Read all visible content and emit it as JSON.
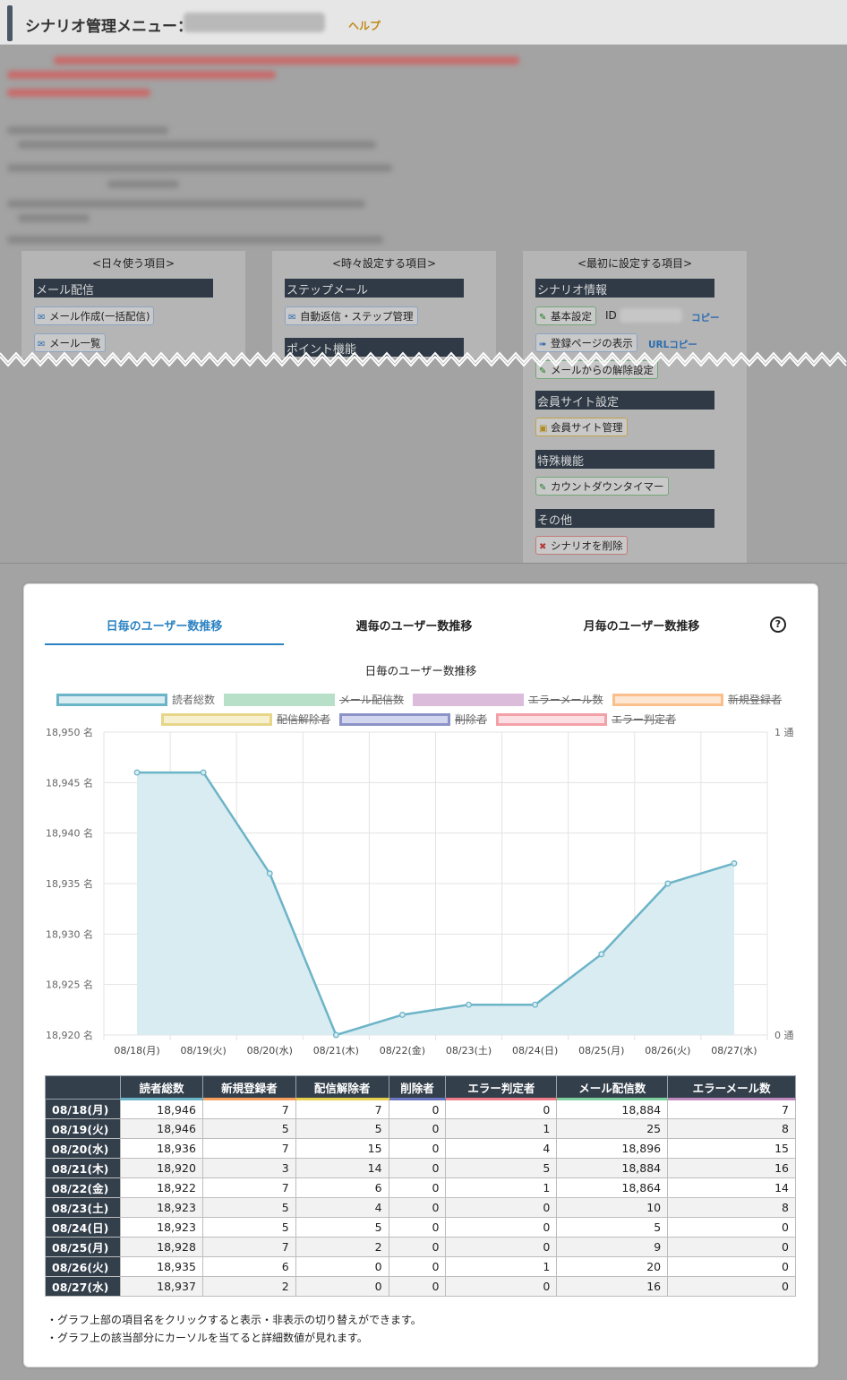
{
  "header": {
    "title": "シナリオ管理メニュー：",
    "help_label": "ヘルプ"
  },
  "menu": {
    "daily": {
      "heading": "<日々使う項目>",
      "sections": [
        {
          "title": "メール配信",
          "buttons": [
            "メール作成(一括配信)",
            "メール一覧"
          ]
        }
      ]
    },
    "sometimes": {
      "heading": "<時々設定する項目>",
      "sections": [
        {
          "title": "ステップメール",
          "buttons": [
            "自動返信・ステップ管理"
          ]
        },
        {
          "title": "ポイント機能",
          "buttons": []
        }
      ]
    },
    "initial": {
      "heading": "<最初に設定する項目>",
      "sections": [
        {
          "title": "シナリオ情報",
          "buttons": [
            "基本設定",
            "登録ページの表示",
            "メールからの解除設定"
          ]
        },
        {
          "title": "会員サイト設定",
          "buttons": [
            "会員サイト管理"
          ]
        },
        {
          "title": "特殊機能",
          "buttons": [
            "カウントダウンタイマー"
          ]
        },
        {
          "title": "その他",
          "buttons": [
            "シナリオを削除"
          ]
        }
      ],
      "id_label": "ID",
      "copy_label": "コピー",
      "url_copy_label": "URLコピー"
    }
  },
  "stats": {
    "tabs": [
      "日毎のユーザー数推移",
      "週毎のユーザー数推移",
      "月毎のユーザー数推移"
    ],
    "active_tab": 0,
    "help_icon": "?",
    "chart_title": "日毎のユーザー数推移",
    "legend": [
      {
        "label": "読者総数",
        "color": "#6cb4c7",
        "fill": "#d9ecf2",
        "active": true
      },
      {
        "label": "メール配信数",
        "color": "#b8e0c8",
        "fill": "#b8e0c8",
        "active": false
      },
      {
        "label": "エラーメール数",
        "color": "#dbbcdb",
        "fill": "#dbbcdb",
        "active": false
      },
      {
        "label": "新規登録者",
        "color": "#f9c08e",
        "fill": "#fde7d3",
        "active": false
      },
      {
        "label": "配信解除者",
        "color": "#e7d58a",
        "fill": "#f6f0cf",
        "active": false
      },
      {
        "label": "削除者",
        "color": "#8c93c8",
        "fill": "#d3d6ef",
        "active": false
      },
      {
        "label": "エラー判定者",
        "color": "#f2a1a8",
        "fill": "#fcdfe2",
        "active": false
      }
    ],
    "table": {
      "headers": [
        "",
        "読者総数",
        "新規登録者",
        "配信解除者",
        "削除者",
        "エラー判定者",
        "メール配信数",
        "エラーメール数"
      ],
      "header_underline_colors": [
        "",
        "#6cb4c7",
        "#f9a15e",
        "#e7d04c",
        "#6c75c0",
        "#f07d88",
        "#7fd0a0",
        "#c08ac0"
      ],
      "rows": [
        [
          "08/18(月)",
          "18,946",
          "7",
          "7",
          "0",
          "0",
          "18,884",
          "7"
        ],
        [
          "08/19(火)",
          "18,946",
          "5",
          "5",
          "0",
          "1",
          "25",
          "8"
        ],
        [
          "08/20(水)",
          "18,936",
          "7",
          "15",
          "0",
          "4",
          "18,896",
          "15"
        ],
        [
          "08/21(木)",
          "18,920",
          "3",
          "14",
          "0",
          "5",
          "18,884",
          "16"
        ],
        [
          "08/22(金)",
          "18,922",
          "7",
          "6",
          "0",
          "1",
          "18,864",
          "14"
        ],
        [
          "08/23(土)",
          "18,923",
          "5",
          "4",
          "0",
          "0",
          "10",
          "8"
        ],
        [
          "08/24(日)",
          "18,923",
          "5",
          "5",
          "0",
          "0",
          "5",
          "0"
        ],
        [
          "08/25(月)",
          "18,928",
          "7",
          "2",
          "0",
          "0",
          "9",
          "0"
        ],
        [
          "08/26(火)",
          "18,935",
          "6",
          "0",
          "0",
          "1",
          "20",
          "0"
        ],
        [
          "08/27(水)",
          "18,937",
          "2",
          "0",
          "0",
          "0",
          "16",
          "0"
        ]
      ]
    },
    "notes": [
      "・グラフ上部の項目名をクリックすると表示・非表示の切り替えができます。",
      "・グラフ上の該当部分にカーソルを当てると詳細数値が見れます。"
    ]
  },
  "chart_data": {
    "type": "area",
    "title": "日毎のユーザー数推移",
    "categories": [
      "08/18(月)",
      "08/19(火)",
      "08/20(水)",
      "08/21(木)",
      "08/22(金)",
      "08/23(土)",
      "08/24(日)",
      "08/25(月)",
      "08/26(火)",
      "08/27(水)"
    ],
    "series": [
      {
        "name": "読者総数",
        "values": [
          18946,
          18946,
          18936,
          18920,
          18922,
          18923,
          18923,
          18928,
          18935,
          18937
        ]
      }
    ],
    "ylim": [
      18920,
      18950
    ],
    "y_ticks": [
      "18,920 名",
      "18,925 名",
      "18,930 名",
      "18,935 名",
      "18,940 名",
      "18,945 名",
      "18,950 名"
    ],
    "y2_ticks": [
      "0 通",
      "1 通"
    ],
    "grid": true,
    "legend_position": "top"
  }
}
